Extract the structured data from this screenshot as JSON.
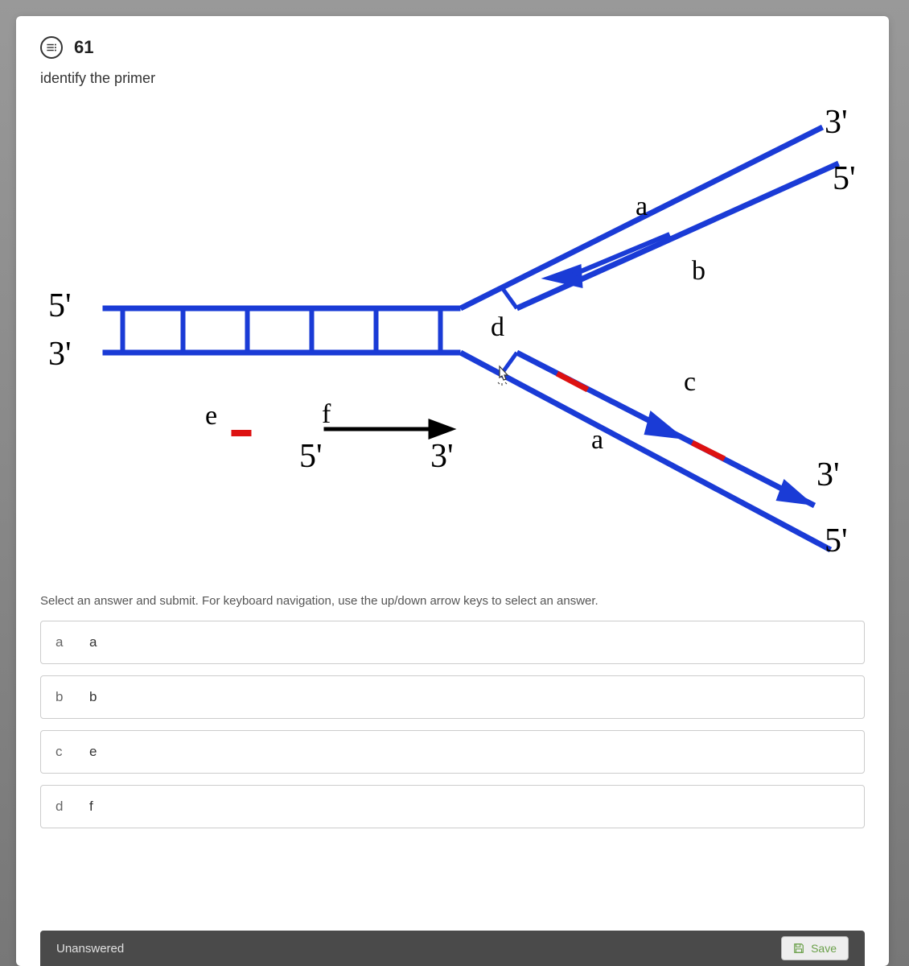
{
  "header": {
    "question_number": "61",
    "question_text": "identify the primer"
  },
  "diagram": {
    "left_top": "5'",
    "left_bottom": "3'",
    "top_right_3": "3'",
    "top_right_5": "5'",
    "bottom_right_3": "3'",
    "bottom_right_5": "5'",
    "label_a_top": "a",
    "label_a_bottom": "a",
    "label_b": "b",
    "label_c": "c",
    "label_d": "d",
    "label_e": "e",
    "label_f": "f",
    "arrow_5": "5'",
    "arrow_3": "3'"
  },
  "instruction": "Select an answer and submit. For keyboard navigation, use the up/down arrow keys to select an answer.",
  "answers": [
    {
      "key": "a",
      "value": "a"
    },
    {
      "key": "b",
      "value": "b"
    },
    {
      "key": "c",
      "value": "e"
    },
    {
      "key": "d",
      "value": "f"
    }
  ],
  "footer": {
    "status": "Unanswered",
    "save_label": "Save"
  }
}
